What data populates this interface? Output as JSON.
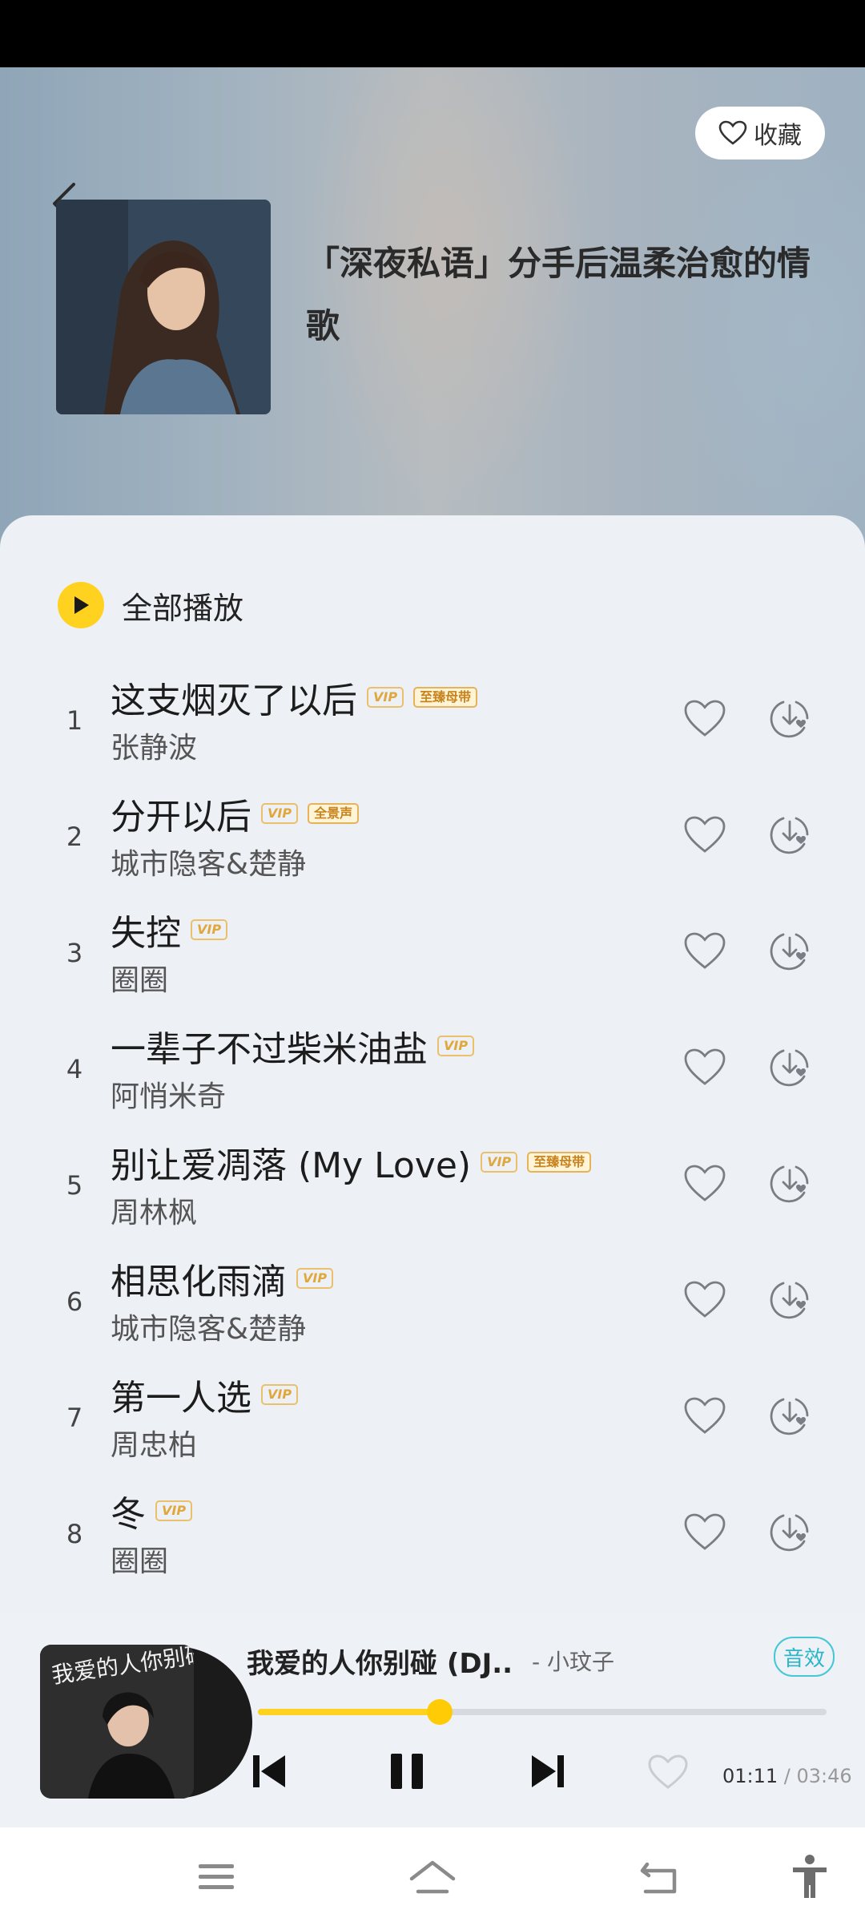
{
  "header": {
    "favorite_label": "收藏",
    "playlist_title": "「深夜私语」分手后温柔治愈的情歌"
  },
  "play_all_label": "全部播放",
  "songs": [
    {
      "index": "1",
      "title": "这支烟灭了以后",
      "artist": "张静波",
      "tags": [
        "VIP",
        "至臻母带"
      ]
    },
    {
      "index": "2",
      "title": "分开以后",
      "artist": "城市隐客&楚静",
      "tags": [
        "VIP",
        "全景声"
      ]
    },
    {
      "index": "3",
      "title": "失控",
      "artist": "圈圈",
      "tags": [
        "VIP"
      ]
    },
    {
      "index": "4",
      "title": "一辈子不过柴米油盐",
      "artist": "阿悄米奇",
      "tags": [
        "VIP"
      ]
    },
    {
      "index": "5",
      "title": "别让爱凋落 (My Love)",
      "artist": "周林枫",
      "tags": [
        "VIP",
        "至臻母带"
      ]
    },
    {
      "index": "6",
      "title": "相思化雨滴",
      "artist": "城市隐客&楚静",
      "tags": [
        "VIP"
      ]
    },
    {
      "index": "7",
      "title": "第一人选",
      "artist": "周忠柏",
      "tags": [
        "VIP"
      ]
    },
    {
      "index": "8",
      "title": "冬",
      "artist": "圈圈",
      "tags": [
        "VIP"
      ]
    }
  ],
  "player": {
    "title": "我爱的人你别碰 (DJ..",
    "artist": "- 小玟子",
    "effect_label": "音效",
    "current_time": "01:11",
    "separator": " / ",
    "total_time": "03:46",
    "progress": 0.32,
    "album_art_text": "我爱的人你别碰"
  },
  "colors": {
    "accent": "#ffd21f",
    "effect": "#2ab6c8",
    "vip_tag": "#e0a83c"
  }
}
